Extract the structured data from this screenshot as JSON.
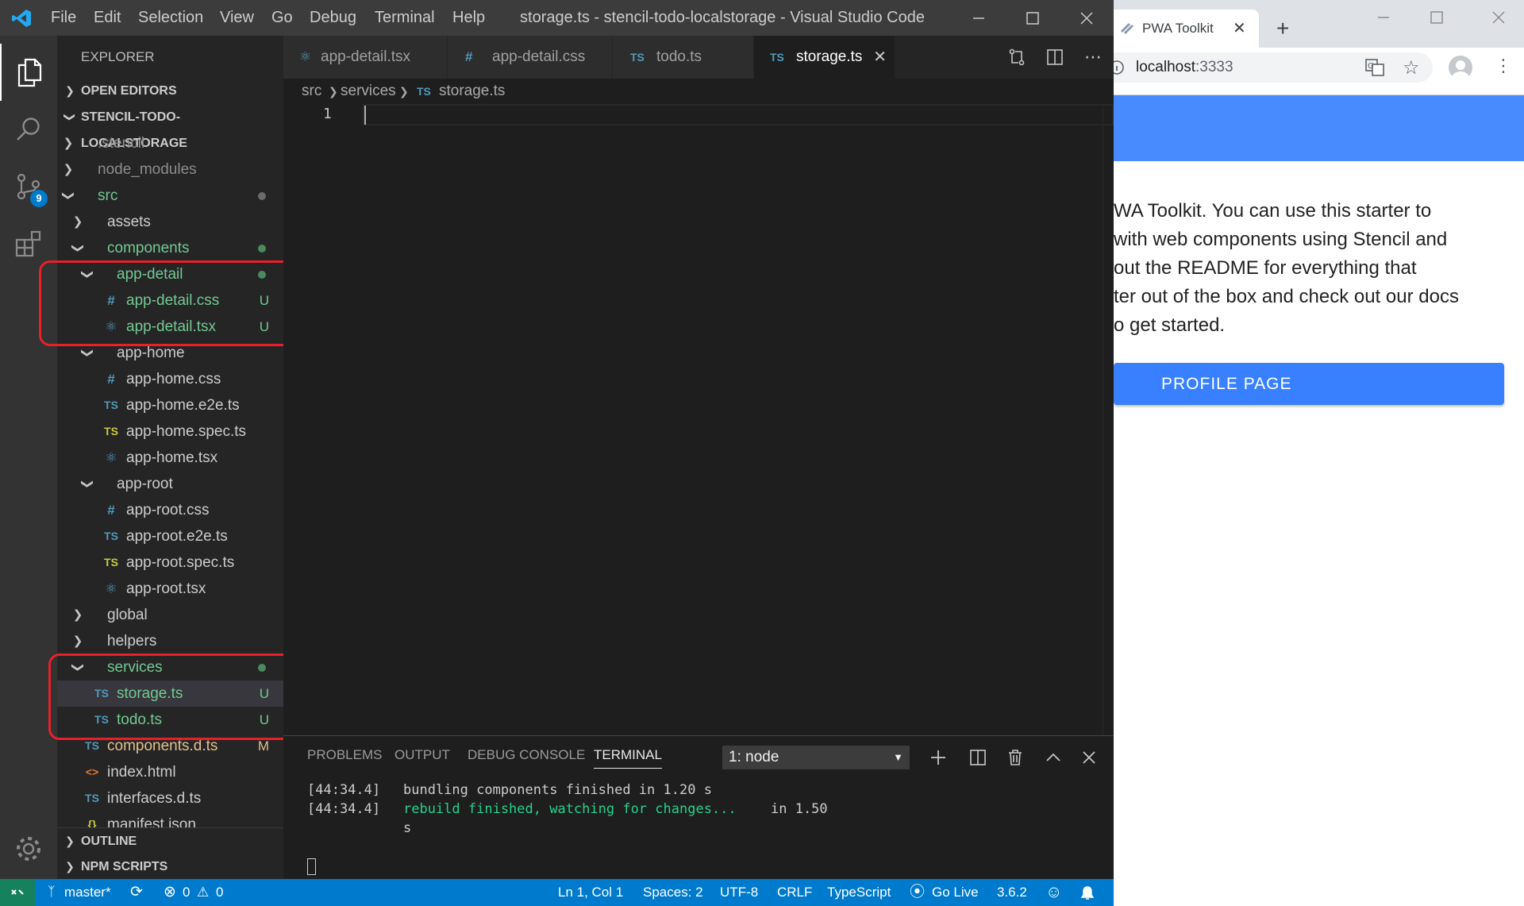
{
  "vscode": {
    "window_title": "storage.ts - stencil-todo-localstorage - Visual Studio Code",
    "menu": [
      "File",
      "Edit",
      "Selection",
      "View",
      "Go",
      "Debug",
      "Terminal",
      "Help"
    ],
    "scm_badge": "9",
    "explorer": {
      "header": "EXPLORER",
      "sections": {
        "open_editors": "OPEN EDITORS",
        "project": "STENCIL-TODO-LOCALSTORAGE",
        "outline": "OUTLINE",
        "npm_scripts": "NPM SCRIPTS"
      },
      "tree": [
        {
          "label": ".stencil",
          "status": ""
        },
        {
          "label": "node_modules",
          "status": ""
        },
        {
          "label": "src",
          "status": ""
        },
        {
          "label": "assets",
          "status": ""
        },
        {
          "label": "components",
          "status": ""
        },
        {
          "label": "app-detail",
          "status": ""
        },
        {
          "label": "app-detail.css",
          "status": "U"
        },
        {
          "label": "app-detail.tsx",
          "status": "U"
        },
        {
          "label": "app-home",
          "status": ""
        },
        {
          "label": "app-home.css",
          "status": ""
        },
        {
          "label": "app-home.e2e.ts",
          "status": ""
        },
        {
          "label": "app-home.spec.ts",
          "status": ""
        },
        {
          "label": "app-home.tsx",
          "status": ""
        },
        {
          "label": "app-root",
          "status": ""
        },
        {
          "label": "app-root.css",
          "status": ""
        },
        {
          "label": "app-root.e2e.ts",
          "status": ""
        },
        {
          "label": "app-root.spec.ts",
          "status": ""
        },
        {
          "label": "app-root.tsx",
          "status": ""
        },
        {
          "label": "global",
          "status": ""
        },
        {
          "label": "helpers",
          "status": ""
        },
        {
          "label": "services",
          "status": ""
        },
        {
          "label": "storage.ts",
          "status": "U"
        },
        {
          "label": "todo.ts",
          "status": "U"
        },
        {
          "label": "components.d.ts",
          "status": "M"
        },
        {
          "label": "index.html",
          "status": ""
        },
        {
          "label": "interfaces.d.ts",
          "status": ""
        },
        {
          "label": "manifest.json",
          "status": ""
        }
      ]
    },
    "tabs": [
      {
        "label": "app-detail.tsx",
        "icon": "react-icon"
      },
      {
        "label": "app-detail.css",
        "icon": "css-icon"
      },
      {
        "label": "todo.ts",
        "icon": "ts-icon"
      },
      {
        "label": "storage.ts",
        "icon": "ts-icon",
        "active": true
      }
    ],
    "breadcrumb": [
      "src",
      "services",
      "storage.ts"
    ],
    "editor": {
      "line_number": "1"
    },
    "panel": {
      "tabs": [
        "PROBLEMS",
        "OUTPUT",
        "DEBUG CONSOLE",
        "TERMINAL"
      ],
      "active_tab": "TERMINAL",
      "terminal_select": "1: node",
      "lines": [
        {
          "time": "[44:34.4]",
          "text": "bundling components finished in 1.20 s"
        },
        {
          "time": "[44:34.4]",
          "text_green": "rebuild finished, watching for changes...",
          "text": "in 1.50",
          "wrap": "s"
        }
      ]
    },
    "statusbar": {
      "branch": "master*",
      "errors": "0",
      "warnings": "0",
      "position": "Ln 1, Col 1",
      "spaces": "Spaces: 2",
      "encoding": "UTF-8",
      "eol": "CRLF",
      "language": "TypeScript",
      "go_live": "Go Live",
      "ts_version": "3.6.2"
    },
    "colors": {
      "accent": "#007acc",
      "untracked": "#73c991",
      "highlight_box": "#e8202a"
    }
  },
  "chrome": {
    "tab_title": "PWA Toolkit",
    "url_host": "localhost",
    "url_port": ":3333",
    "page_lines": [
      "WA Toolkit. You can use this starter to",
      "with web components using Stencil and",
      "out the README for everything that",
      "ter out of the box and check out our docs",
      "o get started."
    ],
    "button_label": "PROFILE PAGE",
    "colors": {
      "toolbar": "#488aff",
      "button": "#3880ff"
    }
  }
}
